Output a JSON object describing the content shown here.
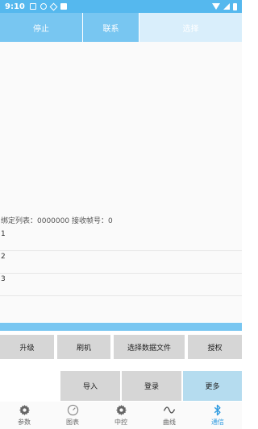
{
  "status_bar": {
    "time": "9:10"
  },
  "top_bar": {
    "stop": "停止",
    "contact": "联系",
    "choose": "选择"
  },
  "status_line": "绑定列表：0000000  接收帧号：0",
  "rows": [
    "1",
    "2",
    "3"
  ],
  "buttons_row1": {
    "upgrade": "升级",
    "flash": "刷机",
    "select_data_file": "选择数据文件",
    "authorize": "授权"
  },
  "buttons_row2": {
    "import": "导入",
    "login": "登录",
    "more": "更多"
  },
  "bottom_nav": [
    {
      "label": "参数",
      "icon": "gear-icon"
    },
    {
      "label": "图表",
      "icon": "gauge-icon"
    },
    {
      "label": "中控",
      "icon": "gear-icon"
    },
    {
      "label": "曲线",
      "icon": "wave-icon"
    },
    {
      "label": "通信",
      "icon": "bluetooth-icon"
    }
  ],
  "colors": {
    "accent": "#78c6f1",
    "status_bar": "#55b8ee",
    "active_nav": "#2f9be0",
    "more_button": "#b5dcef"
  }
}
